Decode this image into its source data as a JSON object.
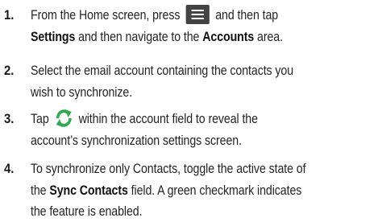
{
  "steps": [
    {
      "number": "1.",
      "lines": [
        {
          "segments": [
            {
              "text": "From the Home screen, press "
            },
            {
              "icon": "menu-icon"
            },
            {
              "text": " and then tap"
            }
          ]
        },
        {
          "segments": [
            {
              "text": "Settings",
              "bold": true
            },
            {
              "text": " and then navigate to the "
            },
            {
              "text": "Accounts",
              "bold": true
            },
            {
              "text": " area."
            }
          ]
        }
      ]
    },
    {
      "number": "2.",
      "lines": [
        {
          "segments": [
            {
              "text": "Select the email account containing the contacts you"
            }
          ]
        },
        {
          "segments": [
            {
              "text": "wish to synchronize."
            }
          ]
        }
      ]
    },
    {
      "number": "3.",
      "lines": [
        {
          "segments": [
            {
              "text": "Tap "
            },
            {
              "icon": "sync-icon"
            },
            {
              "text": " within the account field to reveal the"
            }
          ]
        },
        {
          "segments": [
            {
              "text": "account’s synchronization settings screen."
            }
          ]
        }
      ]
    },
    {
      "number": "4.",
      "lines": [
        {
          "segments": [
            {
              "text": "To synchronize only Contacts, toggle the active state of"
            }
          ]
        },
        {
          "segments": [
            {
              "text": "the "
            },
            {
              "text": "Sync Contacts",
              "bold": true
            },
            {
              "text": " field. A green checkmark indicates"
            }
          ]
        },
        {
          "segments": [
            {
              "text": "the feature is enabled."
            }
          ]
        }
      ]
    }
  ],
  "colors": {
    "text": "#232323",
    "menu_icon_bg": "#444444",
    "sync_icon_green": "#2fa84f"
  }
}
